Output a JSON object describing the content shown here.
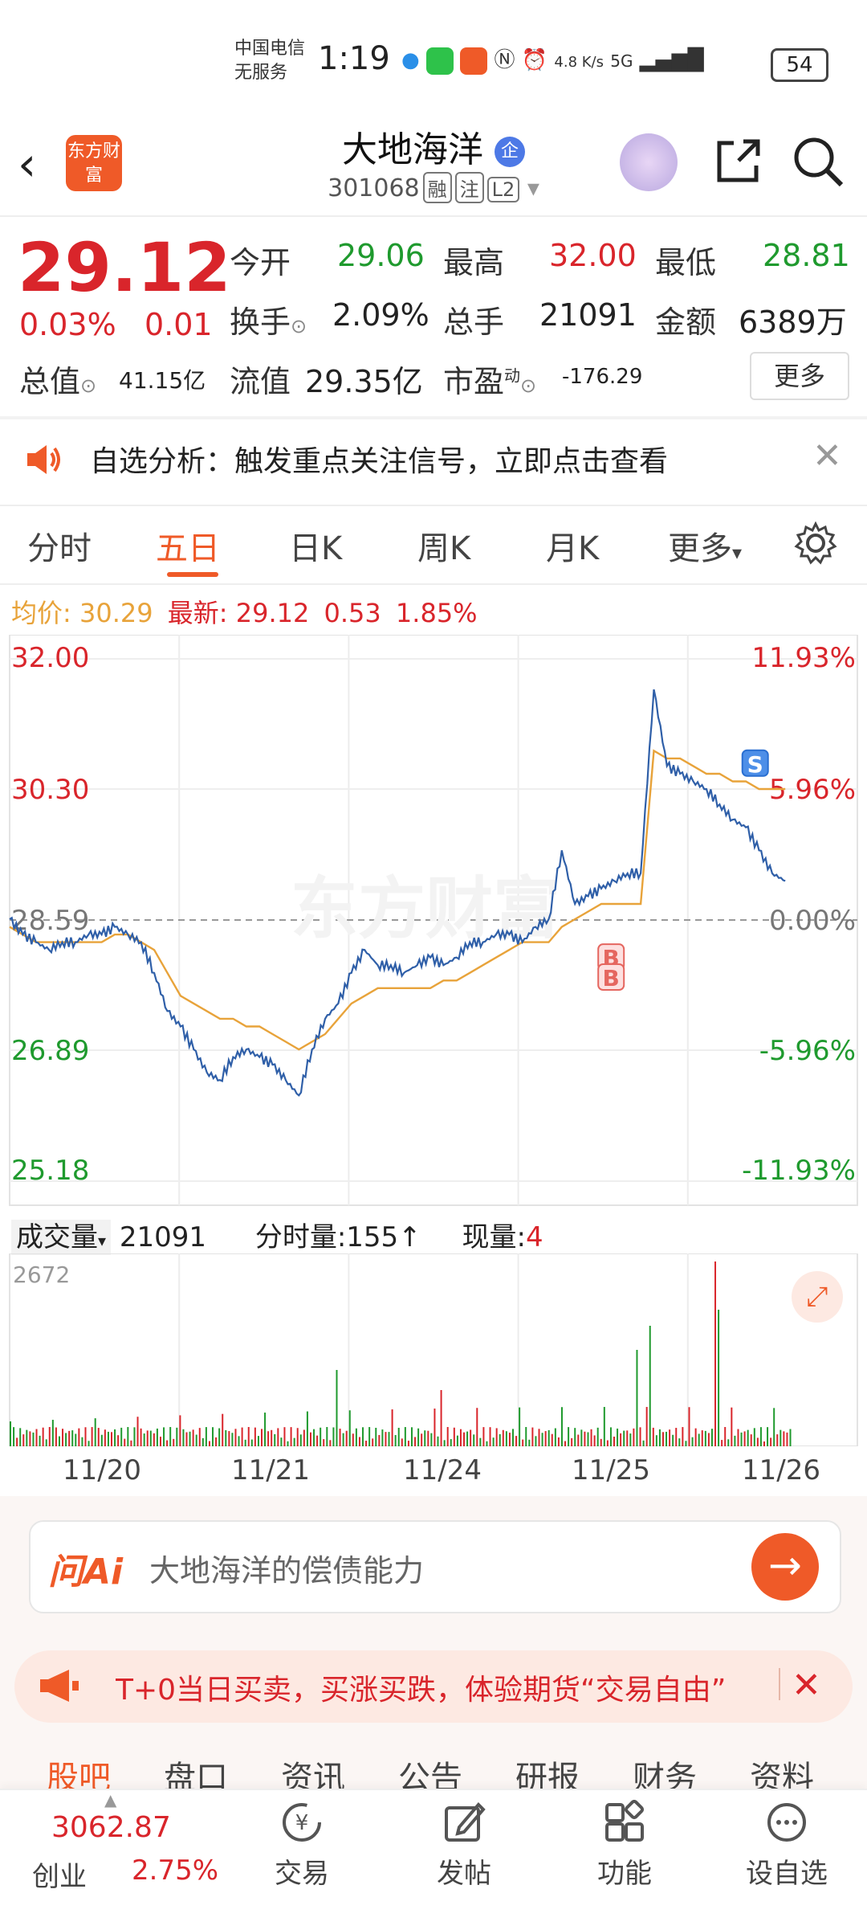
{
  "status": {
    "carrier_line1": "中国电信",
    "carrier_line2": "无服务",
    "time": "1:19",
    "net_speed": "4.8 K/s",
    "network": "5G",
    "battery": "54"
  },
  "header": {
    "stock_name": "大地海洋",
    "qi_badge": "企",
    "stock_code": "301068",
    "badges": [
      "融",
      "注",
      "L2"
    ],
    "logo_text": "东方财富"
  },
  "quote": {
    "price": "29.12",
    "change_pct": "0.03%",
    "change_amt": "0.01",
    "open_label": "今开",
    "open": "29.06",
    "high_label": "最高",
    "high": "32.00",
    "low_label": "最低",
    "low": "28.81",
    "turnover_label": "换手",
    "turnover": "2.09%",
    "volume_label": "总手",
    "volume": "21091",
    "amount_label": "金额",
    "amount": "6389万",
    "total_mv_label": "总值",
    "total_mv": "41.15亿",
    "float_mv_label": "流值",
    "float_mv": "29.35亿",
    "pe_label": "市盈",
    "pe_sup": "动",
    "pe": "-176.29",
    "more": "更多"
  },
  "notice": {
    "text": "自选分析：触发重点关注信号，立即点击查看"
  },
  "tabs": [
    {
      "label": "分时"
    },
    {
      "label": "五日"
    },
    {
      "label": "日K"
    },
    {
      "label": "周K"
    },
    {
      "label": "月K"
    },
    {
      "label": "更多"
    }
  ],
  "avg_line": {
    "avg_label": "均价:",
    "avg": "30.29",
    "latest_label": "最新:",
    "latest": "29.12",
    "chg": "0.53",
    "pct": "1.85%"
  },
  "chart_data": {
    "type": "line",
    "y_left_ticks": [
      "32.00",
      "30.30",
      "28.59",
      "26.89",
      "25.18"
    ],
    "y_right_ticks": [
      "11.93%",
      "5.96%",
      "0.00%",
      "-5.96%",
      "-11.93%"
    ],
    "ylim": [
      25.18,
      32.0
    ],
    "baseline": 28.59,
    "x_dates": [
      "11/20",
      "11/21",
      "11/24",
      "11/25",
      "11/26"
    ],
    "watermark": "东方财富",
    "series": [
      {
        "values": [
          28.6,
          28.4,
          28.3,
          28.2,
          28.3,
          28.3,
          28.4,
          28.4,
          28.5,
          28.4,
          28.3,
          27.9,
          27.4,
          27.2,
          26.9,
          26.6,
          26.5,
          26.8,
          26.9,
          26.8,
          26.7,
          26.5,
          26.3,
          26.9,
          27.3,
          27.5,
          27.9,
          28.2,
          28.0,
          28.0,
          27.9,
          28.0,
          28.1,
          28.0,
          28.1,
          28.3,
          28.3,
          28.4,
          28.4,
          28.3,
          28.5,
          28.6,
          29.5,
          28.8,
          28.9,
          29.0,
          29.1,
          29.2,
          29.2,
          31.6,
          30.6,
          30.5,
          30.4,
          30.3,
          30.1,
          29.9,
          29.8,
          29.5,
          29.2,
          29.1
        ]
      },
      {
        "values": [
          28.5,
          28.4,
          28.3,
          28.3,
          28.3,
          28.3,
          28.3,
          28.3,
          28.4,
          28.4,
          28.3,
          28.2,
          27.9,
          27.6,
          27.5,
          27.4,
          27.3,
          27.3,
          27.2,
          27.2,
          27.1,
          27.0,
          26.9,
          27.0,
          27.1,
          27.3,
          27.5,
          27.6,
          27.7,
          27.7,
          27.7,
          27.7,
          27.7,
          27.8,
          27.8,
          27.9,
          28.0,
          28.1,
          28.2,
          28.3,
          28.3,
          28.3,
          28.5,
          28.6,
          28.7,
          28.8,
          28.8,
          28.8,
          28.8,
          30.8,
          30.7,
          30.7,
          30.6,
          30.5,
          30.5,
          30.4,
          30.4,
          30.3,
          30.3,
          30.3
        ]
      }
    ],
    "markers": [
      {
        "label": "B"
      },
      {
        "label": "B"
      },
      {
        "label": "S"
      }
    ],
    "volume": {
      "label": "成交量",
      "total": "21091",
      "minute_label": "分时量:155↑",
      "now_label": "现量:",
      "now": "4",
      "max_tick": "2672"
    }
  },
  "ai_bar": {
    "logo": "问Ai",
    "placeholder": "大地海洋的偿债能力"
  },
  "promo": {
    "text": "T+0当日买卖，买涨买跌，体验期货“交易自由”"
  },
  "subtabs": [
    {
      "label": "股吧"
    },
    {
      "label": "盘口"
    },
    {
      "label": "资讯"
    },
    {
      "label": "公告"
    },
    {
      "label": "研报"
    },
    {
      "label": "财务"
    },
    {
      "label": "资料"
    }
  ],
  "bottom_nav": {
    "index_value": "3062.87",
    "index_name": "创业",
    "index_pct": "2.75%",
    "items": [
      {
        "label": "交易"
      },
      {
        "label": "发帖"
      },
      {
        "label": "功能"
      },
      {
        "label": "设自选"
      }
    ]
  },
  "colors": {
    "accent": "#ef5a28",
    "up": "#d9252b",
    "down": "#1f9a2e",
    "price_line": "#2f5fa8",
    "avg_line": "#e8a33a"
  }
}
